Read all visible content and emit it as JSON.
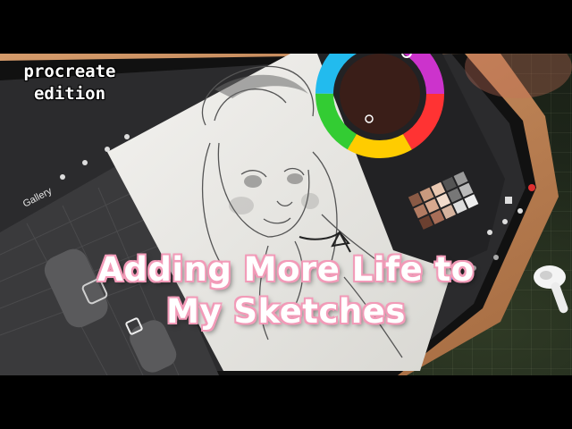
{
  "badge": {
    "line1": "procreate",
    "line2": "edition"
  },
  "title": {
    "line1": "Adding More Life to",
    "line2": "My Sketches"
  },
  "procreate": {
    "toolbar": {
      "gallery_label": "Gallery"
    },
    "color_panel": {
      "active_tab": "Disc"
    },
    "palette_name": "Palette"
  },
  "colors": {
    "title_outline": "#f29bb8",
    "tablet_case": "#c98a5c",
    "canvas": "#ecebe7"
  },
  "icons": [
    "wrench-icon",
    "magic-wand-icon",
    "selection-icon",
    "transform-icon",
    "brush-icon",
    "smudge-icon",
    "eraser-icon",
    "layers-icon",
    "color-icon",
    "earbud-icon"
  ]
}
